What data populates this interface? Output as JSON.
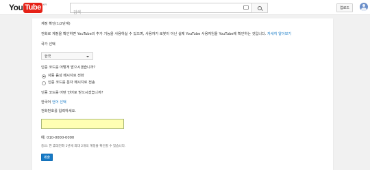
{
  "header": {
    "logo_you": "You",
    "logo_tube": "Tube",
    "logo_region": "KR",
    "search_placeholder": "검색",
    "upload_label": "업로드"
  },
  "verify": {
    "title": "계정 확인(1/2단계)",
    "description": "전화로 계정을 확인하면 YouTube의 추가 기능을 사용하실 수 있으며, 사용자가 로봇이 아닌 실제 YouTube 사용자임을 YouTube에 확인하는 것입니다.",
    "learn_more": "자세히 알아보기",
    "country_label": "국가 선택",
    "country_value": "한국",
    "method_question": "인증 코드를 어떻게 받으시겠습니까?",
    "methods": [
      {
        "label": "자동 음성 메시지로 전화",
        "checked": true
      },
      {
        "label": "인증 코드를 문자 메시지로 전송",
        "checked": false
      }
    ],
    "language_question": "인증 코드를 어떤 언어로 받으시겠습니까?",
    "language_value": "한국어",
    "language_change": "언어 선택",
    "phone_prompt": "전화번호를 입력하세요.",
    "phone_value": "",
    "example": "예: 010-0000-0000",
    "note": "중요: 한 휴대전화 1년에 최대 2개의 계정을 확인할 수 있습니다.",
    "submit_label": "제출"
  }
}
